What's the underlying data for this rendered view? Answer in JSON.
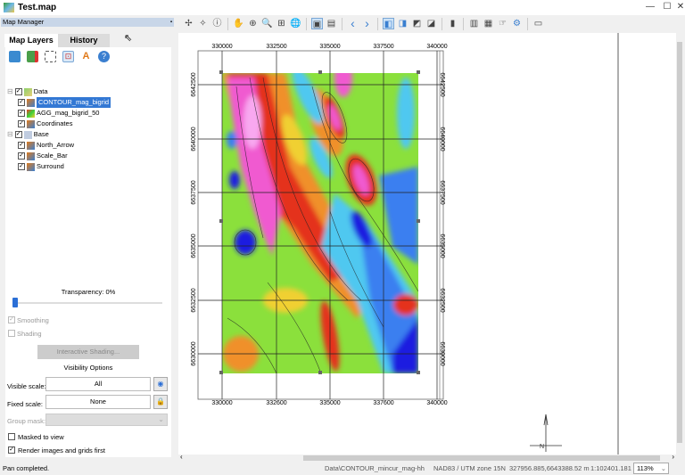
{
  "window": {
    "title": "Test.map",
    "controls": [
      "—",
      "☐",
      "✕"
    ]
  },
  "map_manager": {
    "title": "Map Manager",
    "pin": "📌",
    "tabs": [
      {
        "label": "Map Layers"
      },
      {
        "label": "History"
      }
    ],
    "toolbar_icons": [
      "add-layer-icon",
      "remove-layer-icon",
      "select-area-icon",
      "layer-properties-icon",
      "symbol-icon",
      "help-icon"
    ],
    "tree": [
      {
        "label": "Data",
        "level": 0,
        "checked": true,
        "icon": "folder-data-icon"
      },
      {
        "label": "CONTOUR_mag_bigrid",
        "level": 1,
        "checked": true,
        "selected": true,
        "icon": "vector-layer-icon"
      },
      {
        "label": "AGG_mag_bigrid_50",
        "level": 1,
        "checked": true,
        "icon": "grid-layer-icon"
      },
      {
        "label": "Coordinates",
        "level": 1,
        "checked": true,
        "icon": "vector-layer-icon"
      },
      {
        "label": "Base",
        "level": 0,
        "checked": true,
        "icon": "folder-base-icon"
      },
      {
        "label": "North_Arrow",
        "level": 1,
        "checked": true,
        "icon": "vector-layer-icon"
      },
      {
        "label": "Scale_Bar",
        "level": 1,
        "checked": true,
        "icon": "vector-layer-icon"
      },
      {
        "label": "Surround",
        "level": 1,
        "checked": true,
        "icon": "vector-layer-icon"
      }
    ],
    "transparency_label": "Transparency: 0%",
    "transparency_value": 0,
    "smoothing": {
      "label": "Smoothing",
      "checked": true,
      "disabled": true
    },
    "shading": {
      "label": "Shading",
      "checked": false,
      "disabled": true
    },
    "interactive_shading": "Interactive Shading...",
    "visibility_options": "Visibility Options",
    "visible_scale": {
      "label": "Visible scale:",
      "value": "All"
    },
    "fixed_scale": {
      "label": "Fixed scale:",
      "value": "None"
    },
    "group_mask": {
      "label": "Group mask:",
      "value": ""
    },
    "masked_to_view": {
      "label": "Masked to view",
      "checked": false
    },
    "render_first": {
      "label": "Render images and grids first",
      "checked": true
    }
  },
  "toolbar": {
    "icons": [
      "digitize-icon",
      "point-icon",
      "info-icon",
      "pan-hand-icon",
      "zoom-extent-icon",
      "zoom-icon",
      "zoom-rect-icon",
      "globe-icon",
      "map-view-icon",
      "map-layers-icon",
      "back-icon",
      "forward-icon",
      "layout-1-icon",
      "layout-2-icon",
      "layout-3-icon",
      "layout-4-icon",
      "color-bar-icon",
      "chart-icon",
      "grid-icon",
      "hand-select-icon",
      "settings-icon",
      "snapshot-icon"
    ]
  },
  "map": {
    "x_labels": [
      "330000",
      "332500",
      "335000",
      "337500",
      "340000"
    ],
    "x_labels_bottom": [
      "330000",
      "332600",
      "335000",
      "337600",
      "340000"
    ],
    "y_labels": [
      "6642500",
      "6640000",
      "6637500",
      "6635000",
      "6632500",
      "6630000"
    ]
  },
  "status": {
    "message": "Pan completed.",
    "layer": "Data\\CONTOUR_mincur_mag-hh",
    "projection": "NAD83 / UTM zone 15N",
    "coords": "327956.885,6643388.52 m",
    "scale": "1:102401.181",
    "zoom": "113%"
  }
}
